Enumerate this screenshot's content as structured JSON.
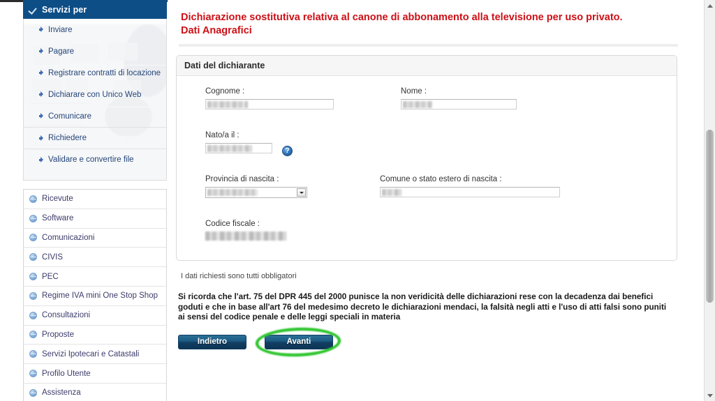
{
  "sidebar": {
    "header": {
      "label": "Servizi per",
      "icon": "check-icon"
    },
    "services": [
      {
        "label": "Inviare"
      },
      {
        "label": "Pagare"
      },
      {
        "label": "Registrare contratti di locazione"
      },
      {
        "label": "Dichiarare con Unico Web"
      },
      {
        "label": "Comunicare"
      },
      {
        "label": "Richiedere"
      },
      {
        "label": "Validare e convertire file"
      }
    ],
    "menu": [
      {
        "label": "Ricevute"
      },
      {
        "label": "Software"
      },
      {
        "label": "Comunicazioni"
      },
      {
        "label": "CIVIS"
      },
      {
        "label": "PEC"
      },
      {
        "label": "Regime IVA mini One Stop Shop"
      },
      {
        "label": "Consultazioni"
      },
      {
        "label": "Proposte"
      },
      {
        "label": "Servizi Ipotecari e Catastali"
      },
      {
        "label": "Profilo Utente"
      },
      {
        "label": "Assistenza"
      }
    ]
  },
  "main": {
    "title_line1": "Dichiarazione sostitutiva relativa al canone di abbonamento alla televisione per uso privato.",
    "title_line2": "Dati Anagrafici",
    "panel_title": "Dati del dichiarante",
    "fields": {
      "cognome_label": "Cognome :",
      "cognome_value": "",
      "nome_label": "Nome :",
      "nome_value": "",
      "nato_label": "Nato/a il :",
      "nato_value": "",
      "help_glyph": "?",
      "provincia_label": "Provincia di nascita :",
      "provincia_value": "",
      "comune_label": "Comune o stato estero di nascita :",
      "comune_value": "",
      "codice_fiscale_label": "Codice fiscale :",
      "codice_fiscale_value": ""
    },
    "note": "I dati richiesti sono tutti obbligatori",
    "warning": "Si ricorda che l'art. 75 del DPR 445 del 2000 punisce la non veridicità delle dichiarazioni rese con la decadenza dai benefici goduti e che in base all'art 76 del medesimo decreto le dichiarazioni mendaci, la falsità negli atti e l'uso di atti falsi sono puniti ai sensi del codice penale e delle leggi speciali in materia",
    "buttons": {
      "back_label": "Indietro",
      "next_label": "Avanti"
    },
    "annotation": {
      "shape": "ellipse",
      "color": "#31c431",
      "target": "Avanti"
    }
  },
  "colors": {
    "title_red": "#cc1016",
    "sidebar_header_blue": "#0e4e86",
    "button_blue": "#1c5b84",
    "highlight_green": "#31c431"
  }
}
